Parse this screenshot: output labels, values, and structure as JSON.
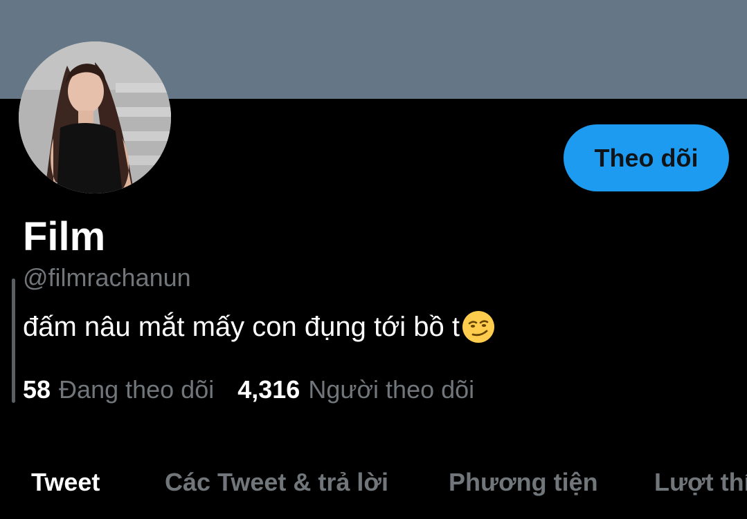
{
  "profile": {
    "name": "Film",
    "handle": "@filmrachanun",
    "bio": "đấm nâu mắt mấy con đụng tới bồ t",
    "bio_emoji": "smirking-face-icon"
  },
  "actions": {
    "follow_label": "Theo dõi"
  },
  "stats": {
    "following_count": "58",
    "following_label": "Đang theo dõi",
    "followers_count": "4,316",
    "followers_label": "Người theo dõi"
  },
  "tabs": [
    {
      "label": "Tweet",
      "active": true
    },
    {
      "label": "Các Tweet & trả lời",
      "active": false
    },
    {
      "label": "Phương tiện",
      "active": false
    },
    {
      "label": "Lượt thích",
      "active": false
    }
  ],
  "colors": {
    "banner": "#657786",
    "accent": "#1d9bf0",
    "background": "#000000",
    "muted_text": "#71767b"
  }
}
